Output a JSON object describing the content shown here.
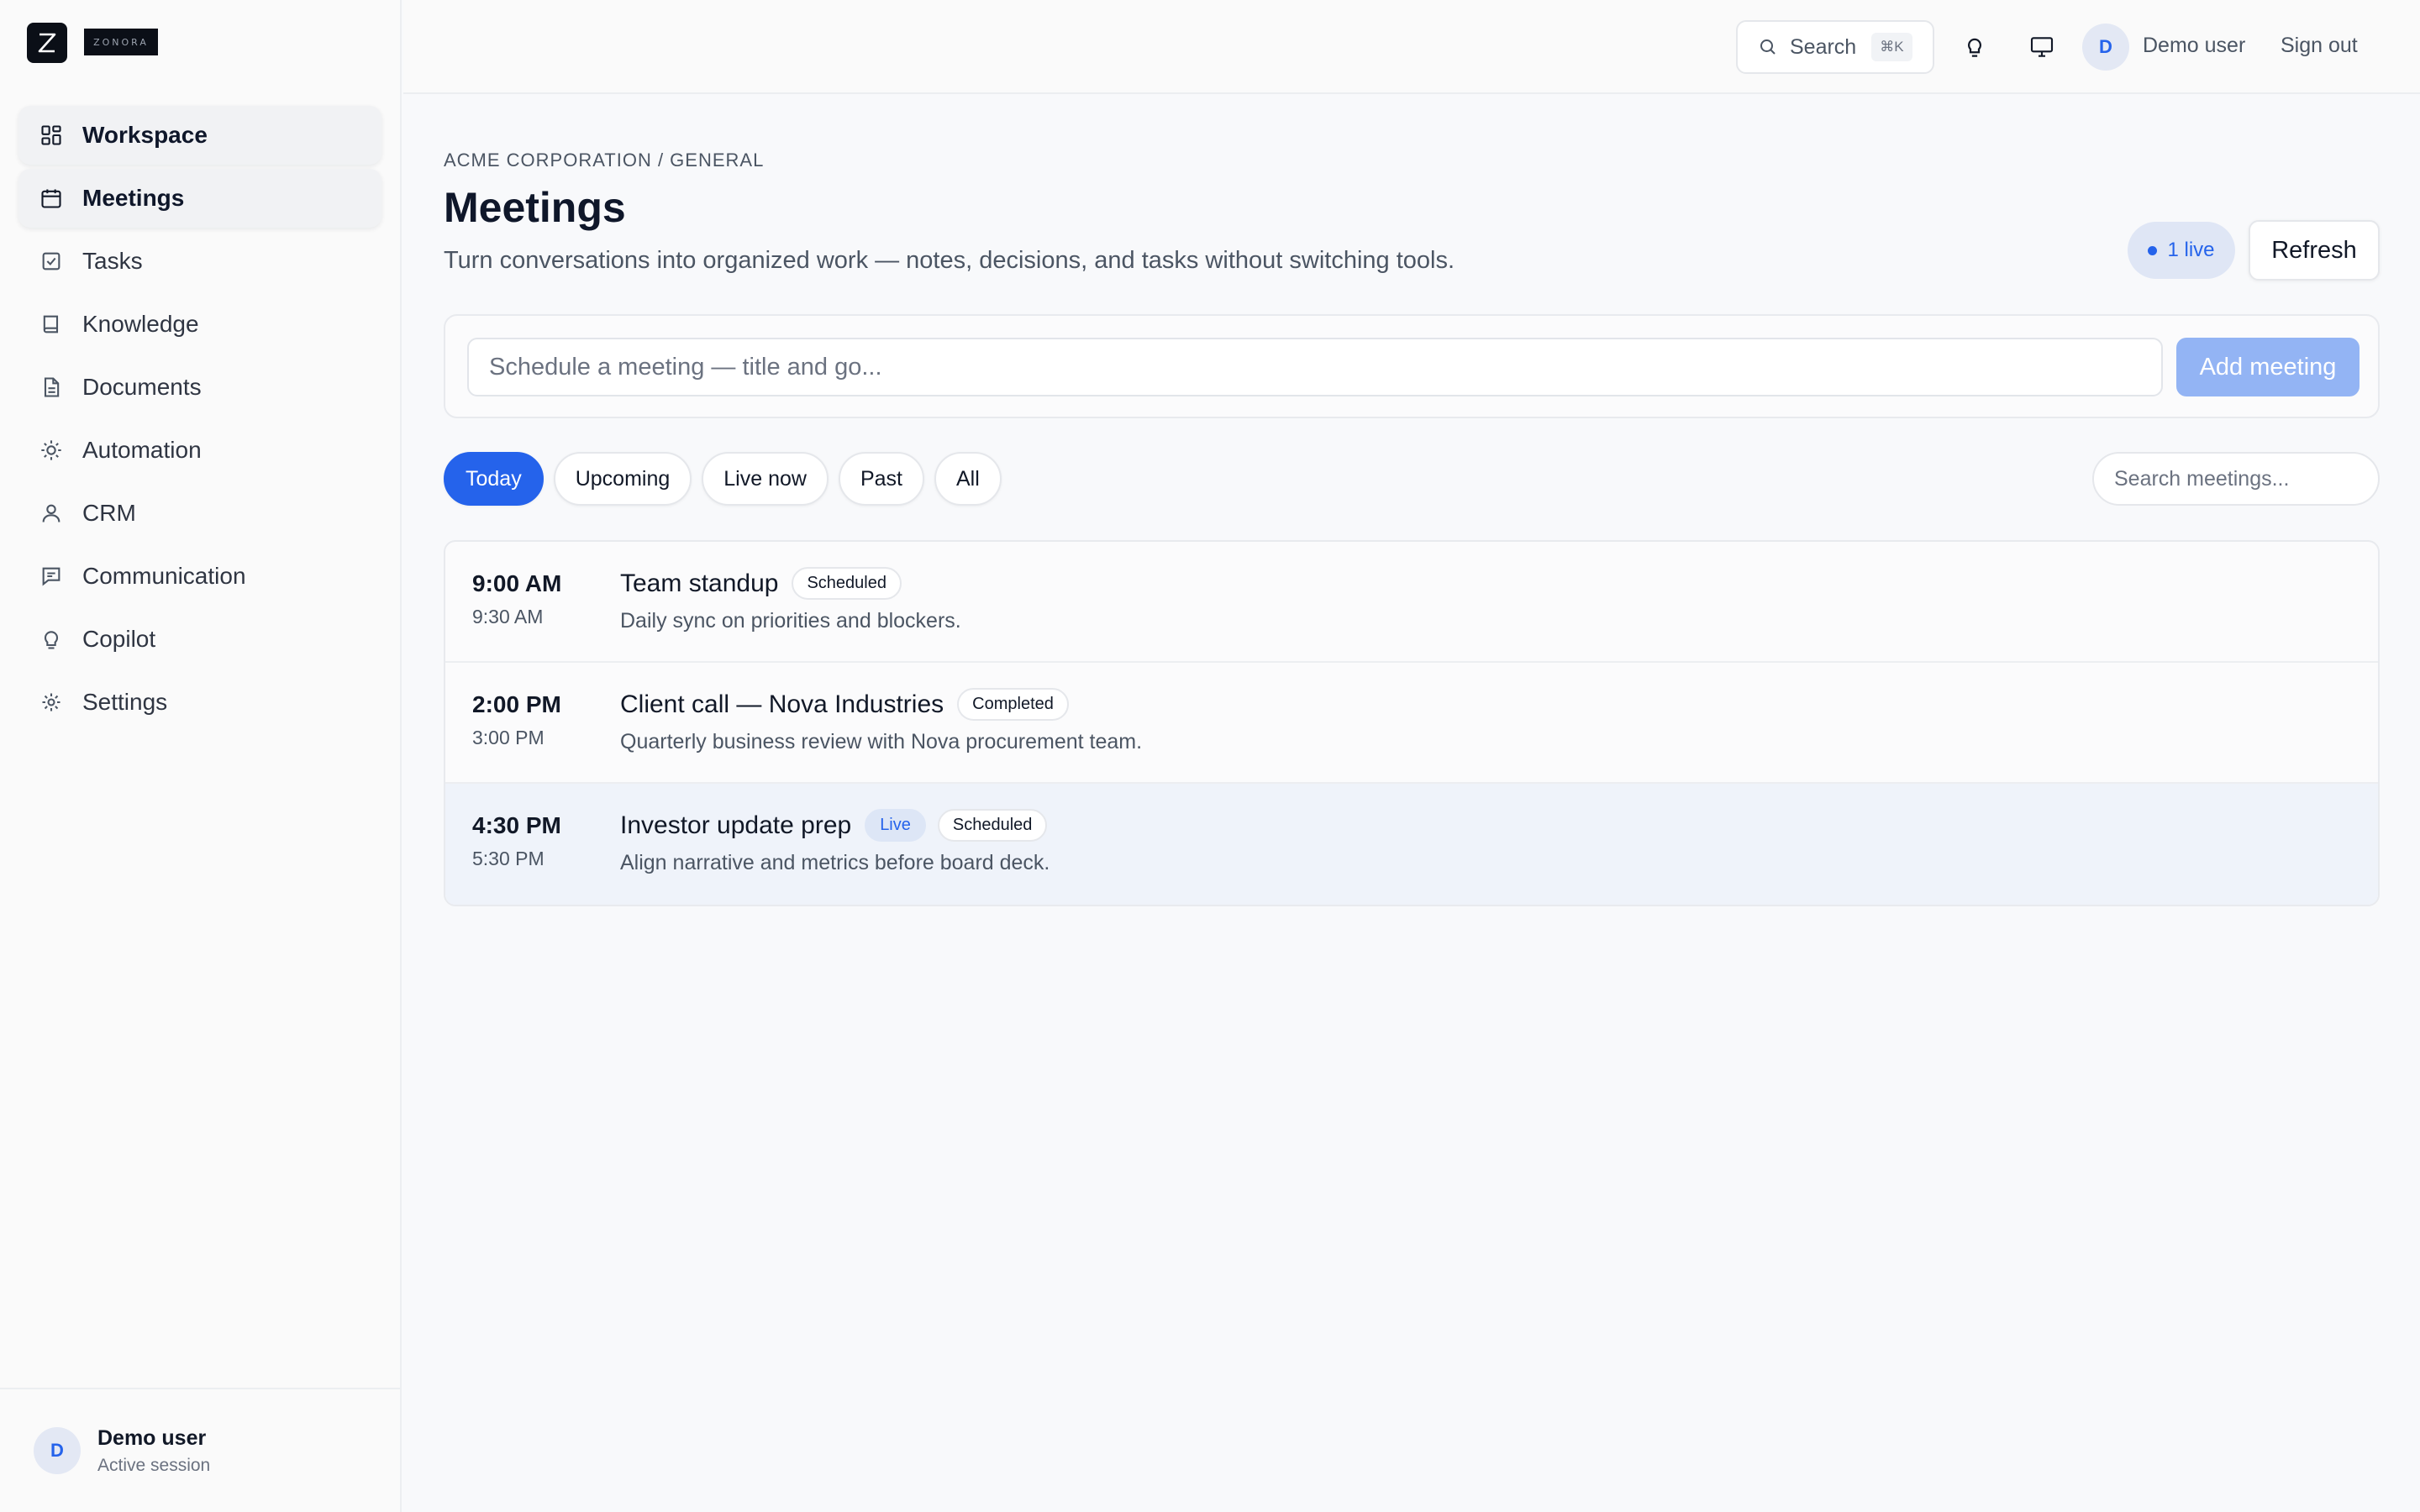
{
  "brand": {
    "logo_letter": "Z",
    "wordmark": "ZONORA"
  },
  "sidebar": {
    "items": [
      {
        "label": "Workspace",
        "icon": "grid-icon",
        "active": true
      },
      {
        "label": "Meetings",
        "icon": "calendar-icon",
        "active": true
      },
      {
        "label": "Tasks",
        "icon": "checkbox-icon",
        "active": false
      },
      {
        "label": "Knowledge",
        "icon": "book-icon",
        "active": false
      },
      {
        "label": "Documents",
        "icon": "document-icon",
        "active": false
      },
      {
        "label": "Automation",
        "icon": "sun-icon",
        "active": false
      },
      {
        "label": "CRM",
        "icon": "person-icon",
        "active": false
      },
      {
        "label": "Communication",
        "icon": "message-icon",
        "active": false
      },
      {
        "label": "Copilot",
        "icon": "lightbulb-icon",
        "active": false
      },
      {
        "label": "Settings",
        "icon": "gear-icon",
        "active": false
      }
    ],
    "footer": {
      "avatar_initial": "D",
      "name": "Demo user",
      "status": "Active session"
    }
  },
  "topbar": {
    "search_label": "Search",
    "search_shortcut": "⌘K",
    "avatar_initial": "D",
    "user_name": "Demo user",
    "signout_label": "Sign out"
  },
  "header": {
    "breadcrumb": "ACME CORPORATION / GENERAL",
    "title": "Meetings",
    "subtitle": "Turn conversations into organized work — notes, decisions, and tasks without switching tools.",
    "live_count": "1 live",
    "refresh_label": "Refresh"
  },
  "composer": {
    "placeholder": "Schedule a meeting — title and go...",
    "add_label": "Add meeting"
  },
  "filters": {
    "tabs": [
      "Today",
      "Upcoming",
      "Live now",
      "Past",
      "All"
    ],
    "active": "Today",
    "search_placeholder": "Search meetings..."
  },
  "meetings": [
    {
      "start": "9:00 AM",
      "end": "9:30 AM",
      "title": "Team standup",
      "badges": [
        "Scheduled"
      ],
      "live": false,
      "description": "Daily sync on priorities and blockers."
    },
    {
      "start": "2:00 PM",
      "end": "3:00 PM",
      "title": "Client call — Nova Industries",
      "badges": [
        "Completed"
      ],
      "live": false,
      "description": "Quarterly business review with Nova procurement team."
    },
    {
      "start": "4:30 PM",
      "end": "5:30 PM",
      "title": "Investor update prep",
      "live_label": "Live",
      "badges": [
        "Scheduled"
      ],
      "live": true,
      "description": "Align narrative and metrics before board deck."
    }
  ],
  "colors": {
    "accent": "#2563eb",
    "accent_light": "#93b4f4",
    "live_bg": "#dfe6f5"
  }
}
